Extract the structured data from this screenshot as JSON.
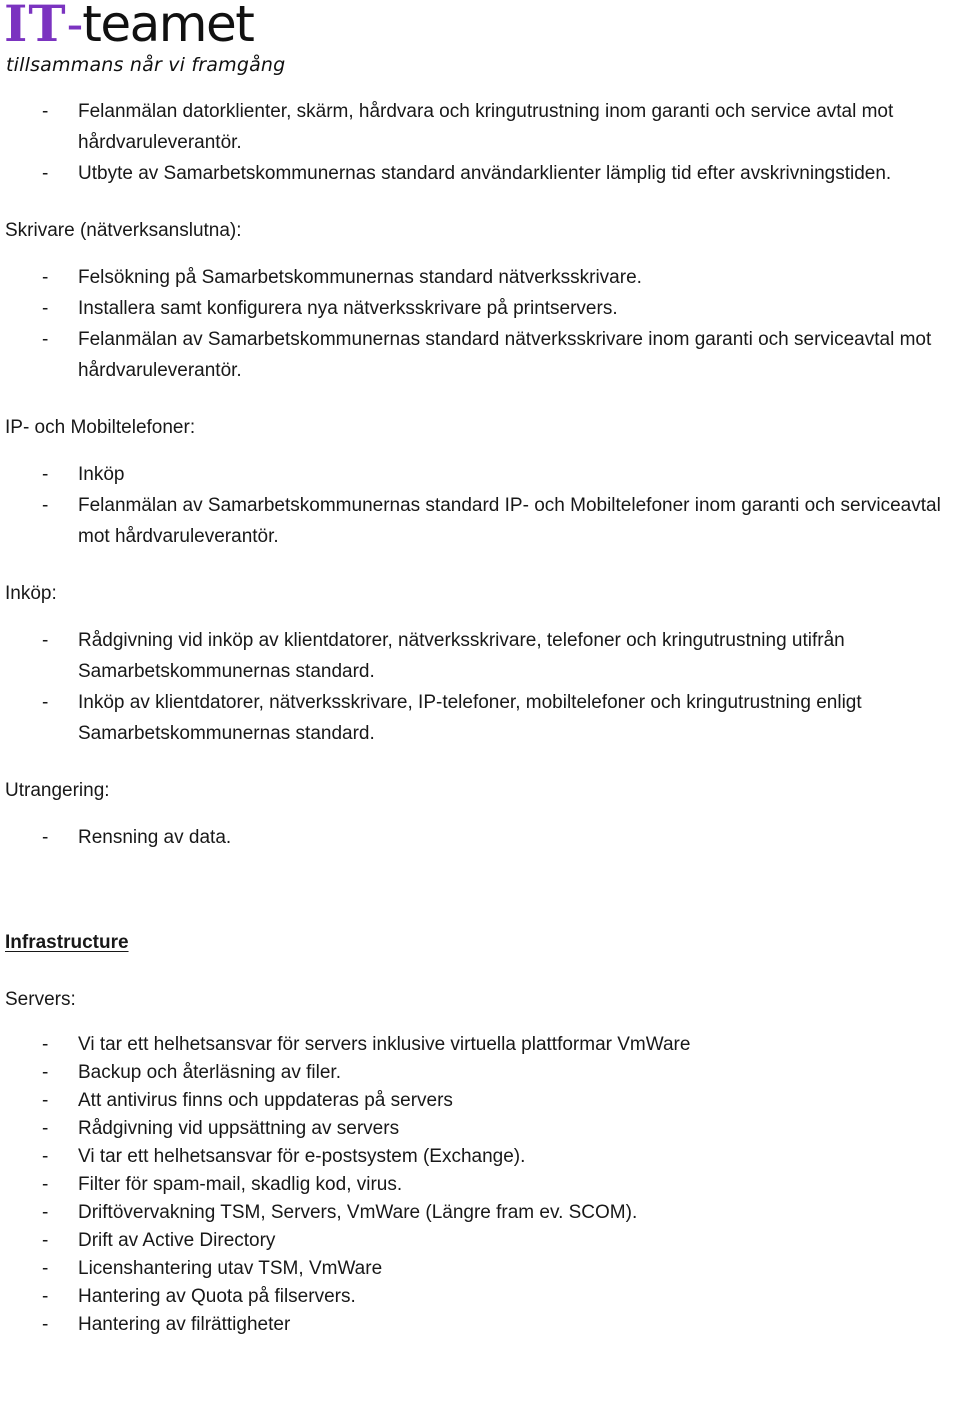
{
  "logo": {
    "mark_it": "IT",
    "mark_dash": "-",
    "mark_teamet": "teamet",
    "tagline": "tillsammans når vi framgång",
    "accent_color": "#7b33c0",
    "text_color": "#111111"
  },
  "document": {
    "blocks": [
      {
        "type": "list",
        "items": [
          "Felanmälan datorklienter, skärm, hårdvara och kringutrustning inom garanti och service avtal mot hårdvaruleverantör.",
          "Utbyte av Samarbetskommunernas standard användarklienter lämplig tid efter avskrivningstiden."
        ]
      },
      {
        "type": "heading",
        "text": "Skrivare (nätverksanslutna):"
      },
      {
        "type": "list",
        "items": [
          "Felsökning på Samarbetskommunernas standard nätverksskrivare.",
          "Installera samt konfigurera nya nätverksskrivare på printservers.",
          "Felanmälan av Samarbetskommunernas standard nätverksskrivare inom garanti och serviceavtal mot hårdvaruleverantör."
        ]
      },
      {
        "type": "heading",
        "text": "IP- och Mobiltelefoner:"
      },
      {
        "type": "list",
        "items": [
          "Inköp",
          "Felanmälan av Samarbetskommunernas standard IP- och Mobiltelefoner inom garanti och serviceavtal mot hårdvaruleverantör."
        ]
      },
      {
        "type": "heading",
        "text": "Inköp:"
      },
      {
        "type": "list",
        "items": [
          "Rådgivning vid inköp av klientdatorer, nätverksskrivare, telefoner och kringutrustning utifrån Samarbetskommunernas standard.",
          "Inköp av klientdatorer, nätverksskrivare, IP-telefoner, mobiltelefoner och kringutrustning enligt Samarbetskommunernas standard."
        ]
      },
      {
        "type": "heading",
        "text": "Utrangering:"
      },
      {
        "type": "list",
        "items": [
          "Rensning av data."
        ]
      },
      {
        "type": "title",
        "text": "Infrastructure"
      },
      {
        "type": "heading",
        "text": "Servers:"
      },
      {
        "type": "list_tight",
        "items": [
          "Vi tar ett helhetsansvar för servers inklusive virtuella plattformar VmWare",
          "Backup och återläsning av filer.",
          "Att antivirus finns och uppdateras på servers",
          "Rådgivning vid uppsättning av servers",
          "Vi tar ett helhetsansvar för e-postsystem (Exchange).",
          "Filter för spam-mail, skadlig kod, virus.",
          "Driftövervakning TSM, Servers, VmWare (Längre fram ev. SCOM).",
          "Drift av Active Directory",
          "Licenshantering utav TSM, VmWare",
          "Hantering av Quota på filservers.",
          "Hantering av filrättigheter"
        ]
      }
    ],
    "bullet_marker": "-"
  }
}
